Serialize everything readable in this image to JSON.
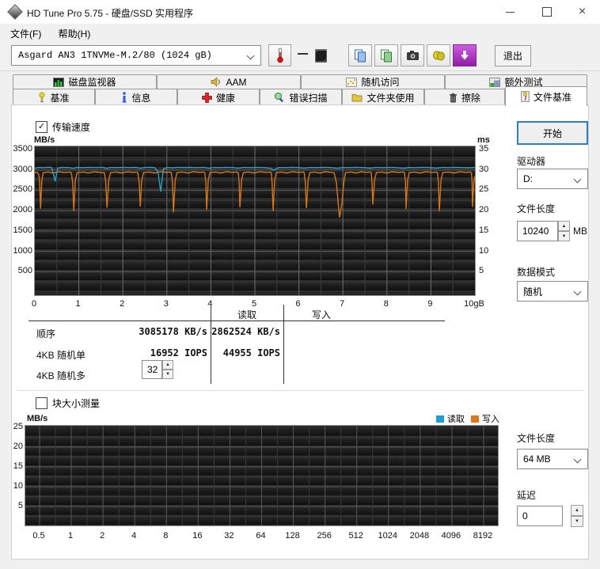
{
  "window": {
    "title": "HD Tune Pro 5.75 - 硬盘/SSD 实用程序",
    "controls": {
      "minimize": "",
      "maximize": "",
      "close": "×"
    }
  },
  "menu": {
    "items": [
      "文件(F)",
      "帮助(H)"
    ]
  },
  "toolbar": {
    "drive_select": "Asgard AN3 1TNVMe-M.2/80 (1024 gB)",
    "temperature_value": "—",
    "exit_label": "退出"
  },
  "tabs": {
    "row1": [
      {
        "label": "磁盘监视器",
        "icon": "disk-monitor-icon"
      },
      {
        "label": "AAM",
        "icon": "speaker-icon"
      },
      {
        "label": "随机访问",
        "icon": "scatter-icon"
      },
      {
        "label": "额外测试",
        "icon": "extra-tests-icon"
      }
    ],
    "row2": [
      {
        "label": "基准",
        "icon": "benchmark-icon"
      },
      {
        "label": "信息",
        "icon": "info-icon"
      },
      {
        "label": "健康",
        "icon": "health-icon"
      },
      {
        "label": "错误扫描",
        "icon": "error-scan-icon"
      },
      {
        "label": "文件夹使用",
        "icon": "folder-icon"
      },
      {
        "label": "擦除",
        "icon": "erase-icon"
      },
      {
        "label": "文件基准",
        "icon": "file-benchmark-icon"
      }
    ],
    "active": "文件基准"
  },
  "benchmark": {
    "transfer_checkbox": "传输速度",
    "transfer_checked": "✓",
    "table": {
      "col_read": "读取",
      "col_write": "写入",
      "rows": [
        {
          "label": "顺序",
          "read": "3085178 KB/s",
          "write": "2862524 KB/s"
        },
        {
          "label": "4KB 随机单",
          "read": "16952 IOPS",
          "write": "44955 IOPS"
        },
        {
          "label": "4KB 随机多",
          "read": "",
          "write": "",
          "spinner": "32"
        }
      ]
    },
    "start_button": "开始",
    "drive_label": "驱动器",
    "drive_value": "D:",
    "file_length_label": "文件长度",
    "file_length_value": "10240",
    "file_length_unit": "MB",
    "data_mode_label": "数据模式",
    "data_mode_value": "随机"
  },
  "block_section": {
    "checkbox_label": "块大小测量",
    "legend": [
      {
        "label": "读取",
        "color": "#1c9ed9"
      },
      {
        "label": "写入",
        "color": "#e0761a"
      }
    ],
    "file_length_label": "文件长度",
    "file_length_value": "64 MB",
    "delay_label": "延迟",
    "delay_value": "0"
  },
  "chart_data": [
    {
      "type": "line",
      "title": "传输速度",
      "unit_left": "MB/s",
      "unit_right": "ms",
      "xlim": [
        0,
        10
      ],
      "ylim_left": [
        0,
        3500
      ],
      "ylim_right": [
        0,
        35
      ],
      "y_ticks_left": [
        3500,
        3000,
        2500,
        2000,
        1500,
        1000,
        500
      ],
      "y_ticks_right": [
        35,
        30,
        25,
        20,
        15,
        10,
        5
      ],
      "x_ticks": [
        "0",
        "1",
        "2",
        "3",
        "4",
        "5",
        "6",
        "7",
        "8",
        "9",
        "10gB"
      ],
      "grid": {
        "x_minor": 0.5,
        "x_major": 1,
        "y_minor": 250,
        "y_major": 500
      },
      "series": [
        {
          "name": "写入",
          "color": "#d4761b",
          "axis": "left",
          "points": [
            [
              0,
              2935
            ],
            [
              0.05,
              2945
            ],
            [
              0.09,
              2880
            ],
            [
              0.11,
              2700
            ],
            [
              0.13,
              2050
            ],
            [
              0.16,
              2750
            ],
            [
              0.19,
              2930
            ],
            [
              0.3,
              2950
            ],
            [
              0.42,
              2925
            ],
            [
              0.55,
              2955
            ],
            [
              0.68,
              2935
            ],
            [
              0.78,
              2950
            ],
            [
              0.83,
              2930
            ],
            [
              0.86,
              2700
            ],
            [
              0.885,
              1990
            ],
            [
              0.92,
              2760
            ],
            [
              0.96,
              2935
            ],
            [
              1.1,
              2950
            ],
            [
              1.22,
              2925
            ],
            [
              1.35,
              2955
            ],
            [
              1.48,
              2940
            ],
            [
              1.58,
              2930
            ],
            [
              1.61,
              2720
            ],
            [
              1.64,
              2070
            ],
            [
              1.68,
              2760
            ],
            [
              1.72,
              2935
            ],
            [
              1.85,
              2950
            ],
            [
              1.98,
              2925
            ],
            [
              2.1,
              2955
            ],
            [
              2.25,
              2940
            ],
            [
              2.32,
              2950
            ],
            [
              2.34,
              2930
            ],
            [
              2.37,
              2710
            ],
            [
              2.395,
              2100
            ],
            [
              2.43,
              2760
            ],
            [
              2.47,
              2935
            ],
            [
              2.6,
              2950
            ],
            [
              2.72,
              2925
            ],
            [
              2.85,
              2955
            ],
            [
              3.0,
              2940
            ],
            [
              3.08,
              2950
            ],
            [
              3.1,
              2930
            ],
            [
              3.13,
              2700
            ],
            [
              3.15,
              1960
            ],
            [
              3.19,
              2750
            ],
            [
              3.23,
              2935
            ],
            [
              3.35,
              2950
            ],
            [
              3.48,
              2925
            ],
            [
              3.6,
              2955
            ],
            [
              3.75,
              2940
            ],
            [
              3.84,
              2950
            ],
            [
              3.86,
              2930
            ],
            [
              3.885,
              2710
            ],
            [
              3.905,
              2020
            ],
            [
              3.94,
              2760
            ],
            [
              3.98,
              2935
            ],
            [
              4.1,
              2950
            ],
            [
              4.22,
              2925
            ],
            [
              4.35,
              2955
            ],
            [
              4.5,
              2940
            ],
            [
              4.6,
              2950
            ],
            [
              4.62,
              2930
            ],
            [
              4.64,
              2720
            ],
            [
              4.66,
              2080
            ],
            [
              4.7,
              2760
            ],
            [
              4.74,
              2935
            ],
            [
              4.85,
              2950
            ],
            [
              4.98,
              2925
            ],
            [
              5.1,
              2955
            ],
            [
              5.25,
              2940
            ],
            [
              5.36,
              2950
            ],
            [
              5.37,
              2930
            ],
            [
              5.39,
              2700
            ],
            [
              5.415,
              1990
            ],
            [
              5.45,
              2755
            ],
            [
              5.49,
              2935
            ],
            [
              5.6,
              2950
            ],
            [
              5.72,
              2925
            ],
            [
              5.85,
              2955
            ],
            [
              6.0,
              2940
            ],
            [
              6.11,
              2950
            ],
            [
              6.12,
              2930
            ],
            [
              6.145,
              2710
            ],
            [
              6.17,
              2060
            ],
            [
              6.21,
              2760
            ],
            [
              6.25,
              2935
            ],
            [
              6.35,
              2950
            ],
            [
              6.48,
              2925
            ],
            [
              6.6,
              2955
            ],
            [
              6.75,
              2940
            ],
            [
              6.8,
              2930
            ],
            [
              6.85,
              2700
            ],
            [
              6.88,
              2350
            ],
            [
              6.925,
              1830
            ],
            [
              6.98,
              2200
            ],
            [
              7.02,
              2700
            ],
            [
              7.06,
              2935
            ],
            [
              7.18,
              2950
            ],
            [
              7.3,
              2925
            ],
            [
              7.42,
              2955
            ],
            [
              7.55,
              2940
            ],
            [
              7.63,
              2950
            ],
            [
              7.645,
              2930
            ],
            [
              7.66,
              2700
            ],
            [
              7.68,
              2150
            ],
            [
              7.72,
              2760
            ],
            [
              7.76,
              2935
            ],
            [
              7.88,
              2950
            ],
            [
              8.0,
              2925
            ],
            [
              8.12,
              2955
            ],
            [
              8.28,
              2940
            ],
            [
              8.38,
              2950
            ],
            [
              8.4,
              2930
            ],
            [
              8.42,
              2710
            ],
            [
              8.435,
              2040
            ],
            [
              8.47,
              2760
            ],
            [
              8.51,
              2935
            ],
            [
              8.62,
              2950
            ],
            [
              8.75,
              2925
            ],
            [
              8.88,
              2955
            ],
            [
              9.02,
              2940
            ],
            [
              9.13,
              2950
            ],
            [
              9.15,
              2930
            ],
            [
              9.17,
              2700
            ],
            [
              9.19,
              1980
            ],
            [
              9.23,
              2760
            ],
            [
              9.27,
              2935
            ],
            [
              9.4,
              2950
            ],
            [
              9.52,
              2925
            ],
            [
              9.65,
              2955
            ],
            [
              9.8,
              2940
            ],
            [
              9.9,
              2950
            ],
            [
              9.92,
              2930
            ],
            [
              9.935,
              2700
            ],
            [
              9.945,
              2090
            ],
            [
              9.975,
              2700
            ],
            [
              10,
              2850
            ]
          ]
        },
        {
          "name": "读取",
          "color": "#2f9dc9",
          "axis": "left",
          "points": [
            [
              0,
              3040
            ],
            [
              0.1,
              3062
            ],
            [
              0.2,
              3055
            ],
            [
              0.3,
              3066
            ],
            [
              0.38,
              3060
            ],
            [
              0.43,
              2880
            ],
            [
              0.46,
              2720
            ],
            [
              0.52,
              3045
            ],
            [
              0.62,
              3062
            ],
            [
              0.75,
              3058
            ],
            [
              0.88,
              3040
            ],
            [
              0.95,
              3062
            ],
            [
              1.1,
              3056
            ],
            [
              1.25,
              3064
            ],
            [
              1.4,
              3058
            ],
            [
              1.55,
              3062
            ],
            [
              1.63,
              3035
            ],
            [
              1.72,
              3060
            ],
            [
              1.85,
              3056
            ],
            [
              2.0,
              3064
            ],
            [
              2.15,
              3058
            ],
            [
              2.3,
              3062
            ],
            [
              2.4,
              3040
            ],
            [
              2.5,
              3060
            ],
            [
              2.62,
              3064
            ],
            [
              2.72,
              3058
            ],
            [
              2.8,
              2950
            ],
            [
              2.86,
              2465
            ],
            [
              2.92,
              3020
            ],
            [
              3.0,
              3060
            ],
            [
              3.12,
              3050
            ],
            [
              3.25,
              3064
            ],
            [
              3.4,
              3058
            ],
            [
              3.55,
              3062
            ],
            [
              3.7,
              3056
            ],
            [
              3.85,
              3062
            ],
            [
              3.95,
              3040
            ],
            [
              4.08,
              3060
            ],
            [
              4.2,
              3056
            ],
            [
              4.35,
              3064
            ],
            [
              4.5,
              3058
            ],
            [
              4.62,
              3042
            ],
            [
              4.75,
              3060
            ],
            [
              4.9,
              3056
            ],
            [
              5.05,
              3064
            ],
            [
              5.2,
              3058
            ],
            [
              5.35,
              3044
            ],
            [
              5.42,
              2990
            ],
            [
              5.55,
              3060
            ],
            [
              5.7,
              3056
            ],
            [
              5.85,
              3064
            ],
            [
              6.0,
              3058
            ],
            [
              6.12,
              3042
            ],
            [
              6.25,
              3060
            ],
            [
              6.4,
              3056
            ],
            [
              6.55,
              3064
            ],
            [
              6.7,
              3058
            ],
            [
              6.88,
              3040
            ],
            [
              7.0,
              3060
            ],
            [
              7.15,
              3056
            ],
            [
              7.3,
              3064
            ],
            [
              7.45,
              3058
            ],
            [
              7.62,
              3044
            ],
            [
              7.75,
              3060
            ],
            [
              7.9,
              3056
            ],
            [
              8.05,
              3064
            ],
            [
              8.2,
              3058
            ],
            [
              8.38,
              3042
            ],
            [
              8.5,
              3060
            ],
            [
              8.65,
              3056
            ],
            [
              8.8,
              3064
            ],
            [
              8.95,
              3058
            ],
            [
              9.12,
              3044
            ],
            [
              9.25,
              3060
            ],
            [
              9.4,
              3056
            ],
            [
              9.55,
              3064
            ],
            [
              9.7,
              3058
            ],
            [
              9.85,
              3052
            ],
            [
              10,
              3060
            ]
          ]
        }
      ]
    },
    {
      "type": "line",
      "title": "块大小测量",
      "unit_left": "MB/s",
      "ylim_left": [
        0,
        25
      ],
      "y_ticks_left": [
        25,
        20,
        15,
        10,
        5
      ],
      "x_ticks": [
        "0.5",
        "1",
        "2",
        "4",
        "8",
        "16",
        "32",
        "64",
        "128",
        "256",
        "512",
        "1024",
        "2048",
        "4096",
        "8192"
      ],
      "grid": {
        "y_minor": 2.5,
        "y_major": 5
      },
      "series": []
    }
  ]
}
